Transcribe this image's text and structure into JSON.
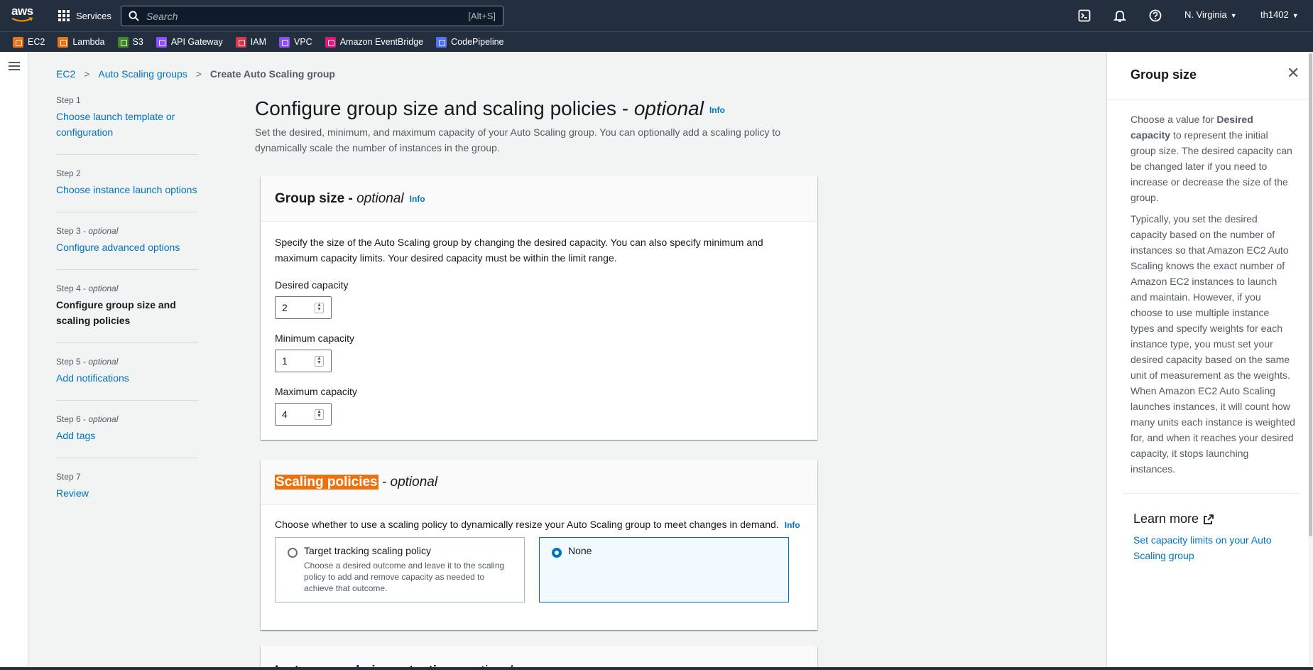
{
  "topnav": {
    "logo_text": "aws",
    "services_label": "Services",
    "search_placeholder": "Search",
    "search_shortcut": "[Alt+S]",
    "region": "N. Virginia",
    "account": "th1402"
  },
  "favorites": [
    {
      "label": "EC2",
      "color": "#ec7211",
      "icon": "ec2-icon"
    },
    {
      "label": "Lambda",
      "color": "#ec7211",
      "icon": "lambda-icon"
    },
    {
      "label": "S3",
      "color": "#3f8624",
      "icon": "s3-icon"
    },
    {
      "label": "API Gateway",
      "color": "#8c4fff",
      "icon": "api-gateway-icon"
    },
    {
      "label": "IAM",
      "color": "#dd344c",
      "icon": "iam-icon"
    },
    {
      "label": "VPC",
      "color": "#8c4fff",
      "icon": "vpc-icon"
    },
    {
      "label": "Amazon EventBridge",
      "color": "#e7157b",
      "icon": "eventbridge-icon"
    },
    {
      "label": "CodePipeline",
      "color": "#4d72f3",
      "icon": "codepipeline-icon"
    }
  ],
  "breadcrumb": {
    "item1": "EC2",
    "item2": "Auto Scaling groups",
    "current": "Create Auto Scaling group"
  },
  "steps": [
    {
      "label": "Step 1",
      "optional": "",
      "title": "Choose launch template or configuration"
    },
    {
      "label": "Step 2",
      "optional": "",
      "title": "Choose instance launch options"
    },
    {
      "label": "Step 3 - ",
      "optional": "optional",
      "title": "Configure advanced options"
    },
    {
      "label": "Step 4 - ",
      "optional": "optional",
      "title": "Configure group size and scaling policies"
    },
    {
      "label": "Step 5 - ",
      "optional": "optional",
      "title": "Add notifications"
    },
    {
      "label": "Step 6 - ",
      "optional": "optional",
      "title": "Add tags"
    },
    {
      "label": "Step 7",
      "optional": "",
      "title": "Review"
    }
  ],
  "main": {
    "title": "Configure group size and scaling policies - ",
    "title_optional": "optional",
    "info": "Info",
    "description": "Set the desired, minimum, and maximum capacity of your Auto Scaling group. You can optionally add a scaling policy to dynamically scale the number of instances in the group."
  },
  "group_size": {
    "title": "Group size - ",
    "title_optional": "optional",
    "info": "Info",
    "description": "Specify the size of the Auto Scaling group by changing the desired capacity. You can also specify minimum and maximum capacity limits. Your desired capacity must be within the limit range.",
    "desired_label": "Desired capacity",
    "desired_value": "2",
    "min_label": "Minimum capacity",
    "min_value": "1",
    "max_label": "Maximum capacity",
    "max_value": "4"
  },
  "scaling": {
    "title": "Scaling policies",
    "title_rest": " - ",
    "title_optional": "optional",
    "description": "Choose whether to use a scaling policy to dynamically resize your Auto Scaling group to meet changes in demand.",
    "info": "Info",
    "option1_title": "Target tracking scaling policy",
    "option1_desc": "Choose a desired outcome and leave it to the scaling policy to add and remove capacity as needed to achieve that outcome.",
    "option2_title": "None",
    "selected": "None"
  },
  "protection": {
    "title": "Instance scale-in protection - ",
    "title_optional": "optional"
  },
  "help": {
    "title": "Group size",
    "para1_a": "Choose a value for ",
    "para1_b": "Desired capacity",
    "para1_c": " to represent the initial group size. The desired capacity can be changed later if you need to increase or decrease the size of the group.",
    "para2": "Typically, you set the desired capacity based on the number of instances so that Amazon EC2 Auto Scaling knows the exact number of Amazon EC2 instances to launch and maintain. However, if you choose to use multiple instance types and specify weights for each instance type, you must set your desired capacity based on the same unit of measurement as the weights. When Amazon EC2 Auto Scaling launches instances, it will count how many units each instance is weighted for, and when it reaches your desired capacity, it stops launching instances.",
    "learn_more": "Learn more",
    "link": "Set capacity limits on your Auto Scaling group"
  }
}
